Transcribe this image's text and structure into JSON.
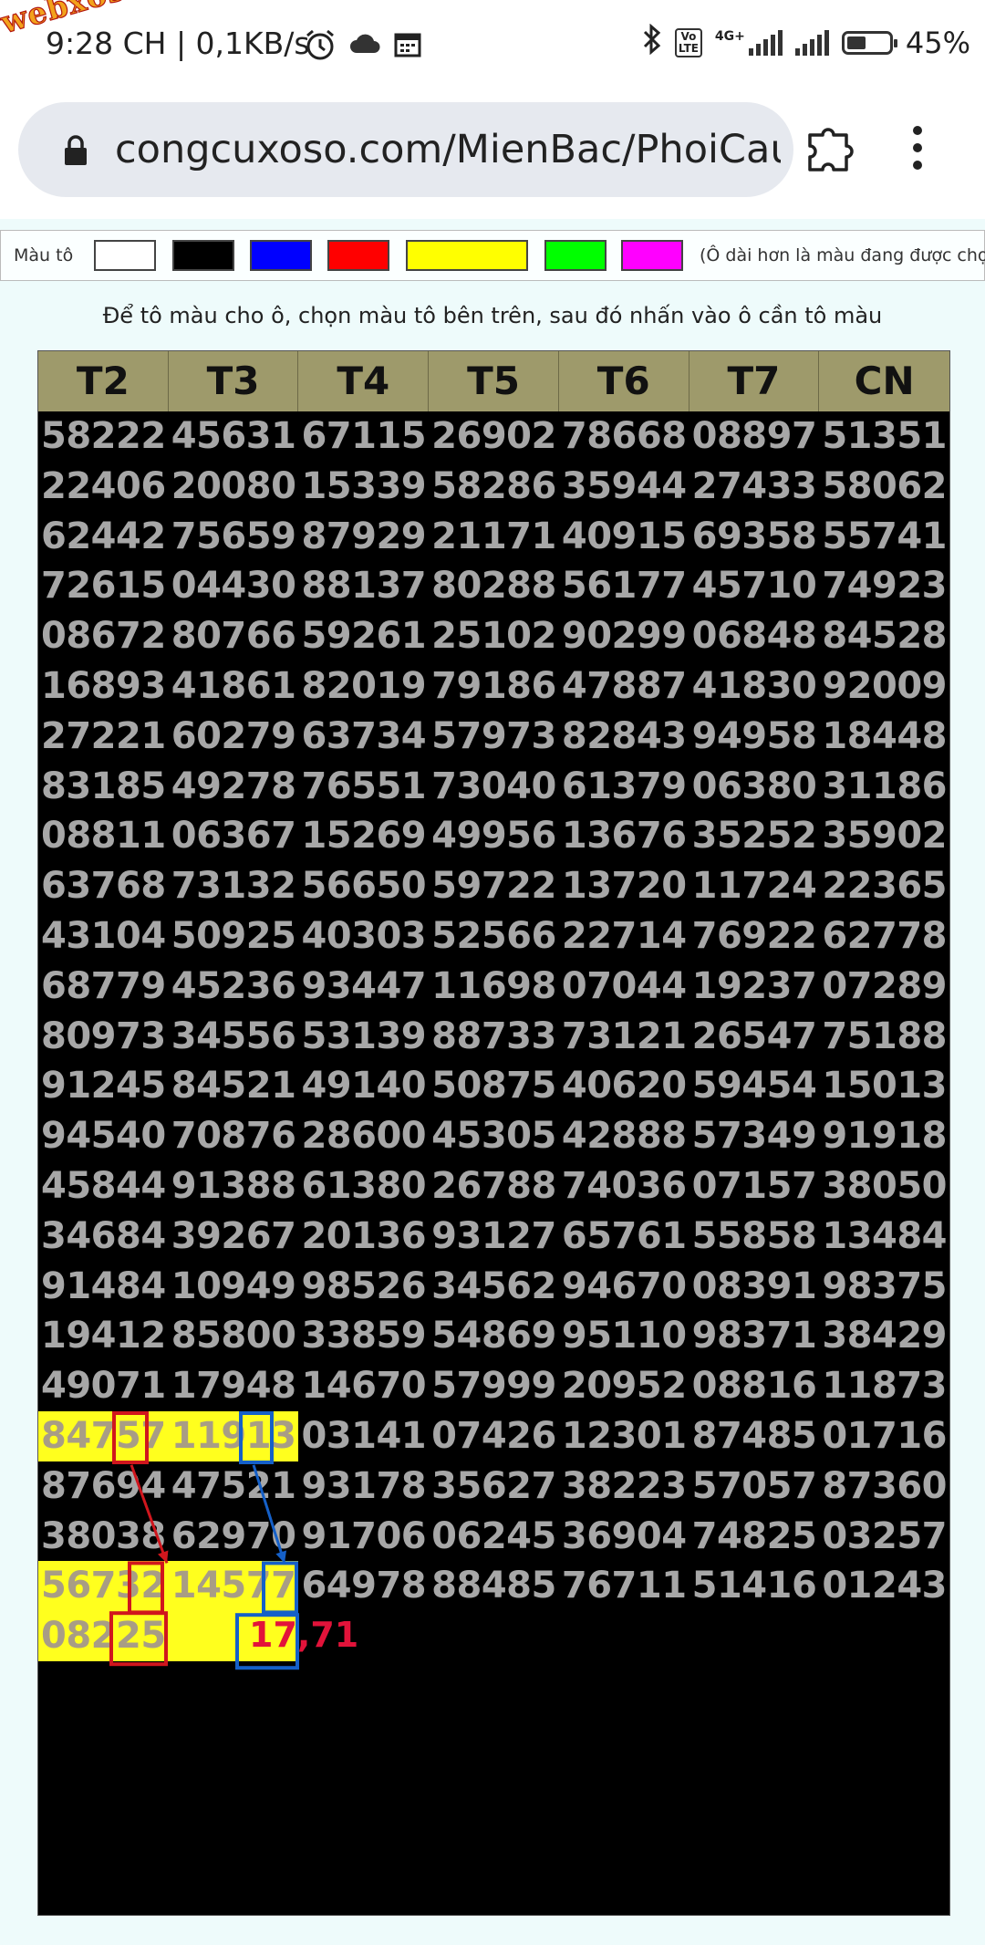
{
  "status_bar": {
    "time_speed": "9:28 CH | 0,1KB/s",
    "watermark": "webxoso.net",
    "volte_label": "Vo LTE",
    "network": "4G+",
    "battery_level": 0.45,
    "battery_text": "45%",
    "icons": [
      "alarm-icon",
      "cloud-icon",
      "calendar-icon",
      "bluetooth-icon",
      "signal-icon",
      "battery-icon"
    ]
  },
  "browser": {
    "url": "congcuxoso.com/MienBac/PhoiCau"
  },
  "palette": {
    "label": "Màu tô",
    "swatches": [
      "#ffffff",
      "#000000",
      "#0000ff",
      "#ff0000",
      "#ffff00",
      "#00ff00",
      "#ff00ff"
    ],
    "note": "(Ô dài hơn là màu đang được chọn)"
  },
  "instruction": "Để tô màu cho ô, chọn màu tô bên trên, sau đó nhấn vào ô cần tô màu",
  "table": {
    "headers": [
      "T2",
      "T3",
      "T4",
      "T5",
      "T6",
      "T7",
      "CN"
    ],
    "rows": [
      [
        "58222",
        "45631",
        "67115",
        "26902",
        "78668",
        "08897",
        "51351"
      ],
      [
        "22406",
        "20080",
        "15339",
        "58286",
        "35944",
        "27433",
        "58062"
      ],
      [
        "62442",
        "75659",
        "87929",
        "21171",
        "40915",
        "69358",
        "55741"
      ],
      [
        "72615",
        "04430",
        "88137",
        "80288",
        "56177",
        "45710",
        "74923"
      ],
      [
        "08672",
        "80766",
        "59261",
        "25102",
        "90299",
        "06848",
        "84528"
      ],
      [
        "16893",
        "41861",
        "82019",
        "79186",
        "47887",
        "41830",
        "92009"
      ],
      [
        "27221",
        "60279",
        "63734",
        "57973",
        "82843",
        "94958",
        "18448"
      ],
      [
        "83185",
        "49278",
        "76551",
        "73040",
        "61379",
        "06380",
        "31186"
      ],
      [
        "08811",
        "06367",
        "15269",
        "49956",
        "13676",
        "35252",
        "35902"
      ],
      [
        "63768",
        "73132",
        "56650",
        "59722",
        "13720",
        "11724",
        "22365"
      ],
      [
        "43104",
        "50925",
        "40303",
        "52566",
        "22714",
        "76922",
        "62778"
      ],
      [
        "68779",
        "45236",
        "93447",
        "11698",
        "07044",
        "19237",
        "07289"
      ],
      [
        "80973",
        "34556",
        "53139",
        "88733",
        "73121",
        "26547",
        "75188"
      ],
      [
        "91245",
        "84521",
        "49140",
        "50875",
        "40620",
        "59454",
        "15013"
      ],
      [
        "94540",
        "70876",
        "28600",
        "45305",
        "42888",
        "57349",
        "91918"
      ],
      [
        "45844",
        "91388",
        "61380",
        "26788",
        "74036",
        "07157",
        "38050"
      ],
      [
        "34684",
        "39267",
        "20136",
        "93127",
        "65761",
        "55858",
        "13484"
      ],
      [
        "91484",
        "10949",
        "98526",
        "34562",
        "94670",
        "08391",
        "98375"
      ],
      [
        "19412",
        "85800",
        "33859",
        "54869",
        "95110",
        "98371",
        "38429"
      ],
      [
        "49071",
        "17948",
        "14670",
        "57999",
        "20952",
        "08816",
        "11873"
      ],
      [
        "84757",
        "11913",
        "03141",
        "07426",
        "12301",
        "87485",
        "01716"
      ],
      [
        "87694",
        "47521",
        "93178",
        "35627",
        "38223",
        "57057",
        "87360"
      ],
      [
        "38038",
        "62970",
        "91706",
        "06245",
        "36904",
        "74825",
        "03257"
      ],
      [
        "56732",
        "14577",
        "64978",
        "88485",
        "76711",
        "51416",
        "01243"
      ],
      [
        "08225",
        "",
        "",
        "",
        "",
        "",
        ""
      ]
    ],
    "highlight_color": "#ffff1e",
    "highlighted": [
      [
        20,
        0
      ],
      [
        20,
        1
      ],
      [
        23,
        0
      ],
      [
        23,
        1
      ],
      [
        24,
        0
      ],
      [
        24,
        1
      ]
    ],
    "prediction_text": "17,71",
    "annotation_colors": {
      "red": "#d0161d",
      "blue": "#1560c8"
    }
  }
}
